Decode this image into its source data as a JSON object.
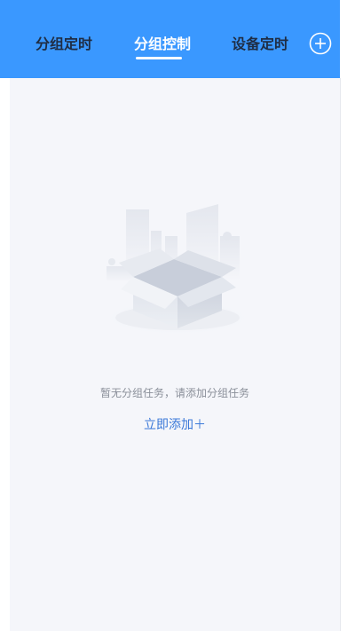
{
  "header": {
    "background": "#3a98ff",
    "tabs": [
      {
        "label": "分组定时",
        "active": false
      },
      {
        "label": "分组控制",
        "active": true
      },
      {
        "label": "设备定时",
        "active": false
      }
    ],
    "add_icon": "circle-plus-icon"
  },
  "empty_state": {
    "illustration": "empty-box-illustration",
    "message": "暂无分组任务，请添加分组任务",
    "action_label": "立即添加＋",
    "action_color": "#3a78d8"
  }
}
